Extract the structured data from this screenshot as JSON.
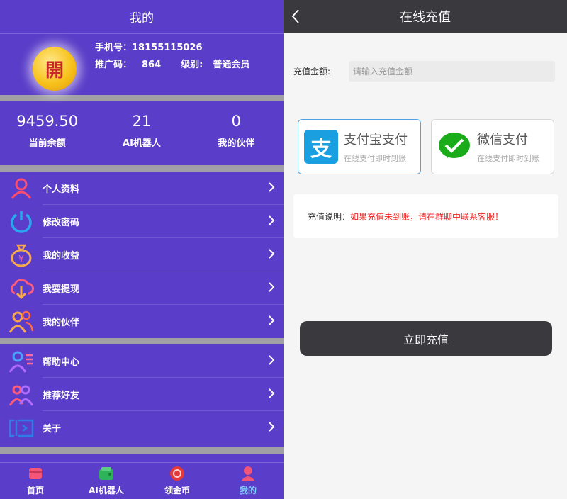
{
  "left": {
    "header_title": "我的",
    "profile": {
      "avatar_char": "開",
      "phone_label": "手机号：",
      "phone": "18155115026",
      "promo_label": "推广码：",
      "promo": "864",
      "level_label": "级别:",
      "level": "普通会员"
    },
    "stats": [
      {
        "value": "9459.50",
        "label": "当前余额"
      },
      {
        "value": "21",
        "label": "AI机器人"
      },
      {
        "value": "0",
        "label": "我的伙伴"
      }
    ],
    "menu_group1": [
      {
        "label": "个人资料",
        "icon": "person-icon"
      },
      {
        "label": "修改密码",
        "icon": "power-icon"
      },
      {
        "label": "我的收益",
        "icon": "money-bag-icon"
      },
      {
        "label": "我要提现",
        "icon": "cloud-download-icon"
      },
      {
        "label": "我的伙伴",
        "icon": "group-icon"
      }
    ],
    "menu_group2": [
      {
        "label": "帮助中心",
        "icon": "help-user-icon"
      },
      {
        "label": "推荐好友",
        "icon": "recommend-icon"
      },
      {
        "label": "关于",
        "icon": "about-icon"
      }
    ],
    "nav": [
      {
        "label": "首页",
        "icon": "home-icon"
      },
      {
        "label": "AI机器人",
        "icon": "wallet-icon"
      },
      {
        "label": "领金币",
        "icon": "coin-icon"
      },
      {
        "label": "我的",
        "icon": "user-icon"
      }
    ]
  },
  "right": {
    "header_title": "在线充值",
    "amount_label": "充值金额:",
    "amount_placeholder": "请输入充值金额",
    "alipay": {
      "title": "支付宝支付",
      "subtitle": "在线支付即时到账",
      "logo_char": "支"
    },
    "wechat": {
      "title": "微信支付",
      "subtitle": "在线支付即时到账"
    },
    "notice_label": "充值说明：",
    "notice_text": "如果充值未到账，请在群聊中联系客服！",
    "submit_label": "立即充值"
  },
  "colors": {
    "left_bg": "#5a3dc8",
    "header_dark": "#3a393e",
    "alipay_blue": "#1a9fe0",
    "wechat_green": "#1aad19",
    "nav_active": "#7fd0ff",
    "notice_red": "#e22222"
  }
}
